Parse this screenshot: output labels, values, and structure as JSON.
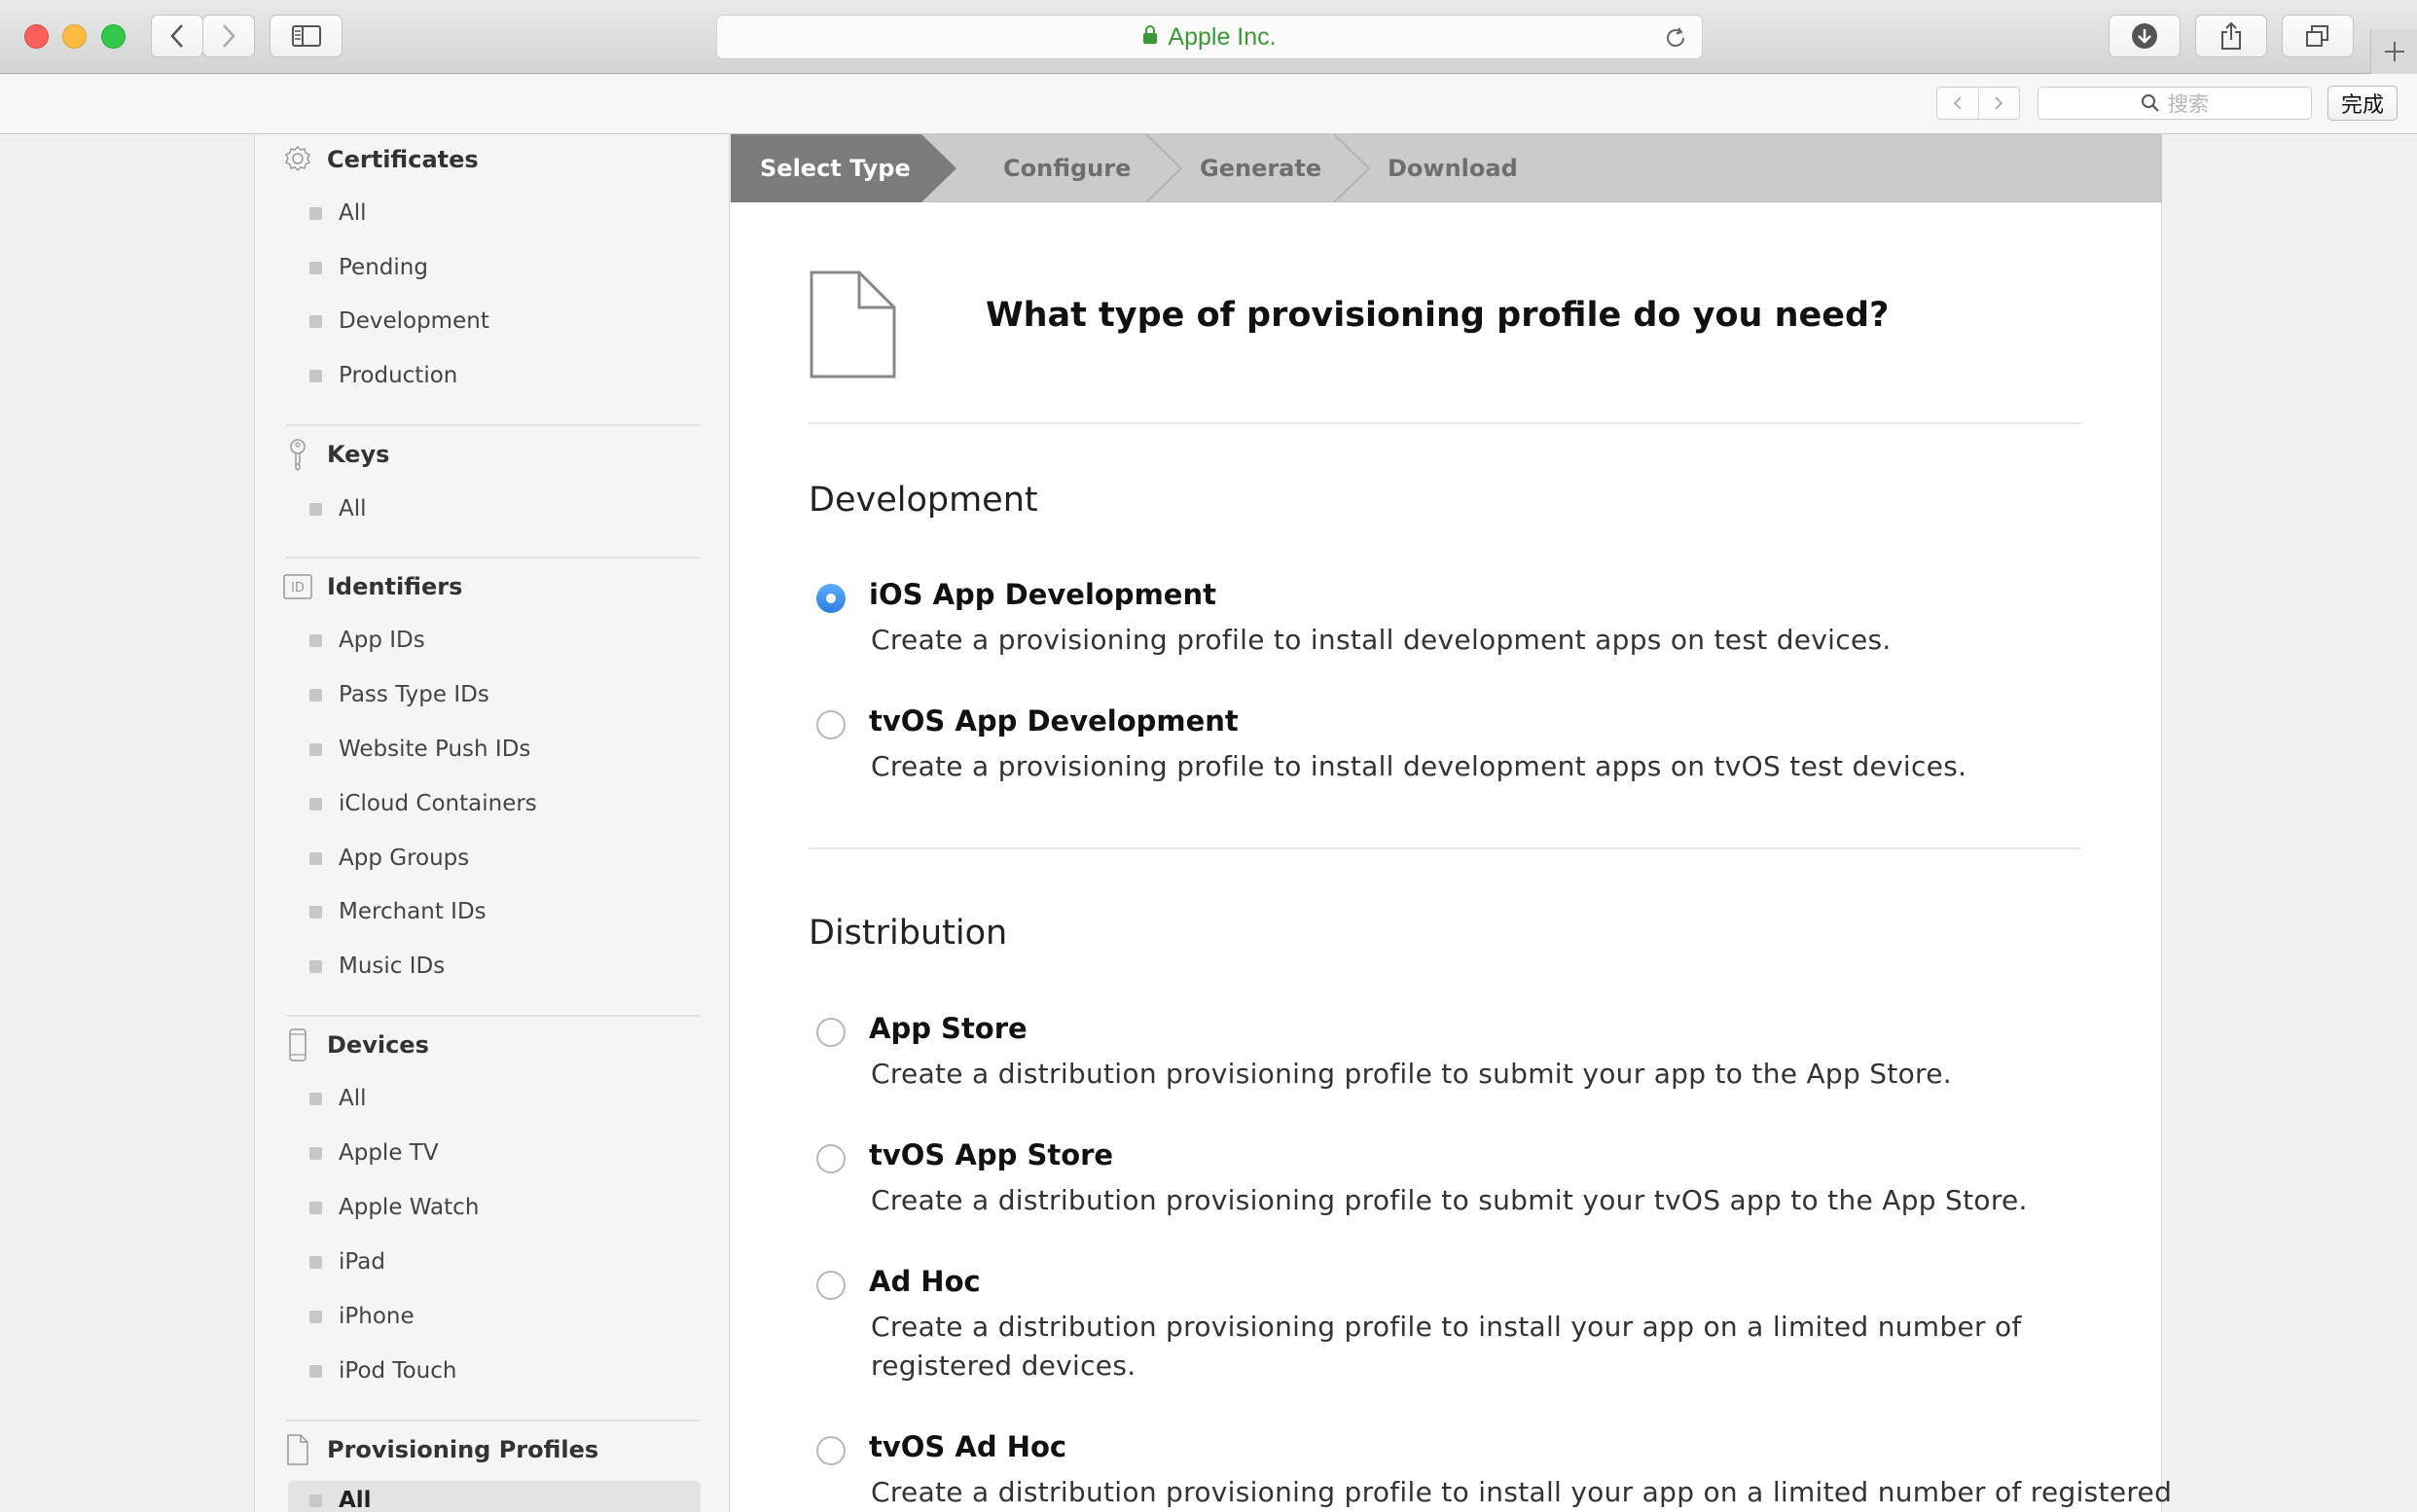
{
  "browser": {
    "address": "Apple Inc.",
    "find_placeholder": "搜索",
    "done_label": "完成"
  },
  "sidebar": {
    "certificates": {
      "title": "Certificates",
      "items": [
        "All",
        "Pending",
        "Development",
        "Production"
      ]
    },
    "keys": {
      "title": "Keys",
      "items": [
        "All"
      ]
    },
    "identifiers": {
      "title": "Identifiers",
      "items": [
        "App IDs",
        "Pass Type IDs",
        "Website Push IDs",
        "iCloud Containers",
        "App Groups",
        "Merchant IDs",
        "Music IDs"
      ]
    },
    "devices": {
      "title": "Devices",
      "items": [
        "All",
        "Apple TV",
        "Apple Watch",
        "iPad",
        "iPhone",
        "iPod Touch"
      ]
    },
    "profiles": {
      "title": "Provisioning Profiles",
      "items": [
        "All"
      ]
    }
  },
  "steps": [
    "Select Type",
    "Configure",
    "Generate",
    "Download"
  ],
  "main": {
    "question": "What type of provisioning profile do you need?",
    "development": {
      "title": "Development",
      "options": [
        {
          "label": "iOS App Development",
          "desc": "Create a provisioning profile to install development apps on test devices.",
          "selected": true
        },
        {
          "label": "tvOS App Development",
          "desc": "Create a provisioning profile to install development apps on tvOS test devices.",
          "selected": false
        }
      ]
    },
    "distribution": {
      "title": "Distribution",
      "options": [
        {
          "label": "App Store",
          "desc": "Create a distribution provisioning profile to submit your app to the App Store.",
          "selected": false
        },
        {
          "label": "tvOS App Store",
          "desc": "Create a distribution provisioning profile to submit your tvOS app to the App Store.",
          "selected": false
        },
        {
          "label": "Ad Hoc",
          "desc": "Create a distribution provisioning profile to install your app on a limited number of registered devices.",
          "selected": false
        },
        {
          "label": "tvOS Ad Hoc",
          "desc": "Create a distribution provisioning profile to install your app on a limited number of registered",
          "selected": false
        }
      ]
    }
  }
}
